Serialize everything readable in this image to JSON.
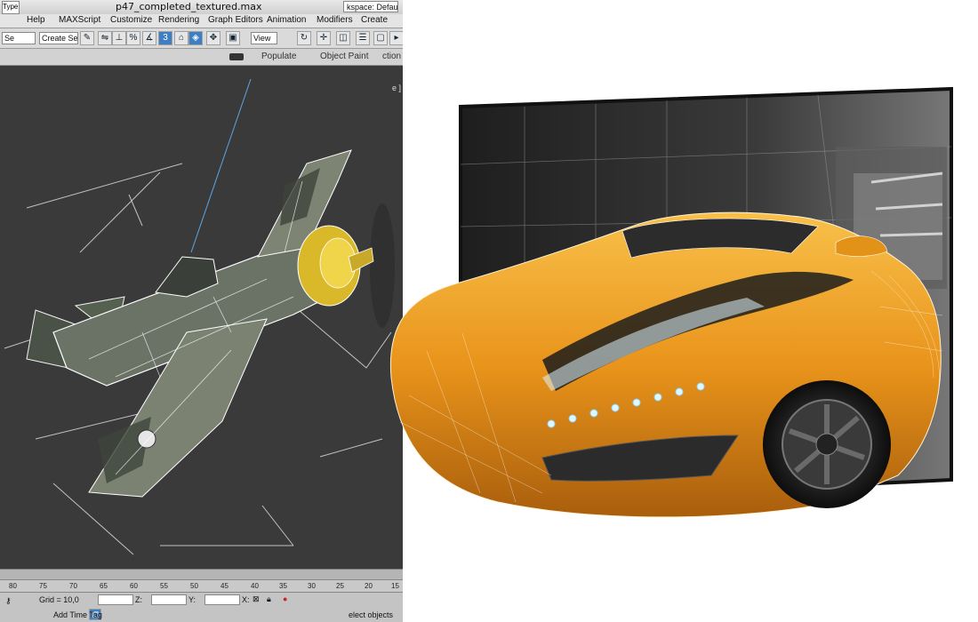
{
  "titlebar": {
    "file_title": "p47_completed_textured.max",
    "workspace_label": "kspace: Default",
    "search_label": "Type a"
  },
  "menu": [
    "Help",
    "MAXScript",
    "Customize",
    "Rendering",
    "Graph Editors",
    "Animation",
    "Modifiers",
    "Create"
  ],
  "toolbar": {
    "selection_set": "Create Selection Se",
    "view_dropdown": "View",
    "left_dropdown": "Se"
  },
  "ribbon": {
    "tabs": [
      "ction",
      "Object Paint",
      "Populate"
    ]
  },
  "viewport": {
    "corner_label": "e ]"
  },
  "timeline": {
    "ticks": [
      "80",
      "75",
      "70",
      "65",
      "60",
      "55",
      "50",
      "45",
      "40",
      "35",
      "30",
      "25",
      "20",
      "15"
    ]
  },
  "status": {
    "grid": "Grid = 10,0",
    "add_time_tag": "Add Time Tag",
    "select_objects": "elect objects",
    "x_label": "X:",
    "y_label": "Y:",
    "z_label": "Z:"
  },
  "colors": {
    "viewport_bg": "#3a3a3a",
    "car_orange": "#e89a1c",
    "ui_gray": "#d2d2d2"
  }
}
